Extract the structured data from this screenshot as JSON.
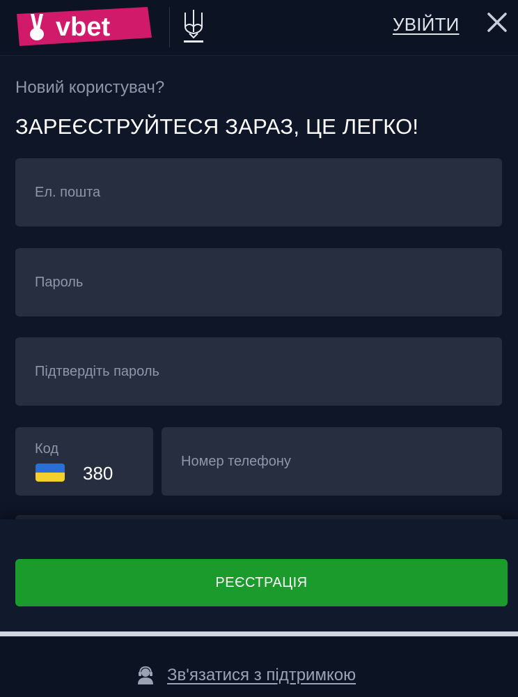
{
  "header": {
    "brand": "vbet",
    "login_label": "УВІЙТИ",
    "icons": {
      "logo": "vbet-logo",
      "emblem": "trident-icon",
      "close": "close-icon"
    }
  },
  "form": {
    "subtitle": "Новий користувач?",
    "headline": "ЗАРЕЄСТРУЙТЕСЯ ЗАРАЗ, ЦЕ ЛЕГКО!",
    "email_placeholder": "Ел. пошта",
    "password_placeholder": "Пароль",
    "confirm_placeholder": "Підтвердіть пароль",
    "code_label": "Код",
    "code_value": "380",
    "phone_placeholder": "Номер телефону"
  },
  "actions": {
    "register_label": "РЕЄСТРАЦІЯ"
  },
  "footer": {
    "support_label": "Зв'язатися з підтримкою",
    "support_icon": "support-agent-icon"
  },
  "colors": {
    "background": "#0e1628",
    "field": "#262e40",
    "accent_green": "#1b9b2b",
    "logo_pink": "#d11b6a",
    "muted_text": "#8e97a8"
  }
}
